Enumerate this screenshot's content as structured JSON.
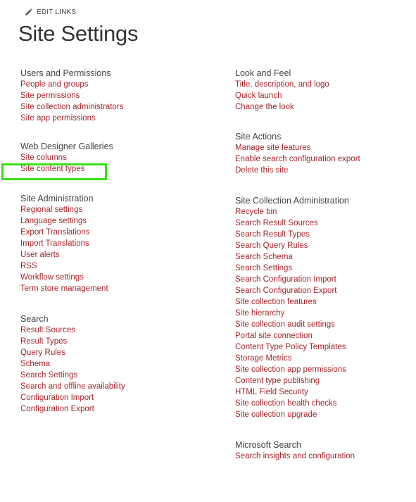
{
  "header": {
    "edit_links_label": "EDIT LINKS",
    "page_title": "Site Settings"
  },
  "colors": {
    "link": "#a4262c",
    "heading": "#444444",
    "title": "#333333",
    "highlight": "#39e019"
  },
  "left_column": {
    "users_permissions": {
      "heading": "Users and Permissions",
      "links": [
        "People and groups",
        "Site permissions",
        "Site collection administrators",
        "Site app permissions"
      ]
    },
    "web_designer_galleries": {
      "heading": "Web Designer Galleries",
      "links": [
        "Site columns",
        "Site content types"
      ]
    },
    "site_administration": {
      "heading": "Site Administration",
      "links": [
        "Regional settings",
        "Language settings",
        "Export Translations",
        "Import Translations",
        "User alerts",
        "RSS",
        "Workflow settings",
        "Term store management"
      ]
    },
    "search": {
      "heading": "Search",
      "links": [
        "Result Sources",
        "Result Types",
        "Query Rules",
        "Schema",
        "Search Settings",
        "Search and offline availability",
        "Configuration Import",
        "Configuration Export"
      ]
    }
  },
  "right_column": {
    "look_and_feel": {
      "heading": "Look and Feel",
      "links": [
        "Title, description, and logo",
        "Quick launch",
        "Change the look"
      ]
    },
    "site_actions": {
      "heading": "Site Actions",
      "links": [
        "Manage site features",
        "Enable search configuration export",
        "Delete this site"
      ]
    },
    "site_collection_administration": {
      "heading": "Site Collection Administration",
      "links": [
        "Recycle bin",
        "Search Result Sources",
        "Search Result Types",
        "Search Query Rules",
        "Search Schema",
        "Search Settings",
        "Search Configuration Import",
        "Search Configuration Export",
        "Site collection features",
        "Site hierarchy",
        "Site collection audit settings",
        "Portal site connection",
        "Content Type Policy Templates",
        "Storage Metrics",
        "Site collection app permissions",
        "Content type publishing",
        "HTML Field Security",
        "Site collection health checks",
        "Site collection upgrade"
      ]
    },
    "microsoft_search": {
      "heading": "Microsoft Search",
      "links": [
        "Search insights and configuration"
      ]
    }
  }
}
